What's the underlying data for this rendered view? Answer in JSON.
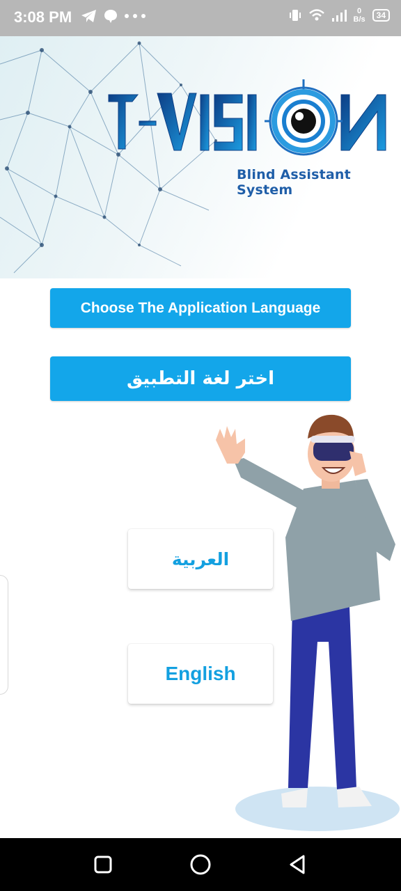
{
  "status_bar": {
    "time": "3:08 PM",
    "net_speed_value": "0",
    "net_speed_unit": "B/s",
    "battery": "34",
    "icons": [
      "telegram-icon",
      "chat-bubble-icon",
      "more-dots-icon",
      "vibrate-icon",
      "wifi-icon",
      "signal-icon",
      "battery-icon"
    ]
  },
  "header": {
    "logo_text": "I-VISION",
    "tagline": "Blind Assistant System"
  },
  "main": {
    "title_en": "Choose The Application Language",
    "title_ar": "اختر لغة التطبيق",
    "option_arabic": "العربية",
    "option_english": "English"
  },
  "colors": {
    "accent": "#13a6ea",
    "logo_blue": "#1f6fc0",
    "status_bar": "#b7b7b7",
    "nav_bar": "#000000"
  },
  "nav_bar": {
    "icons": [
      "recents-square-icon",
      "home-circle-icon",
      "back-triangle-icon"
    ]
  }
}
